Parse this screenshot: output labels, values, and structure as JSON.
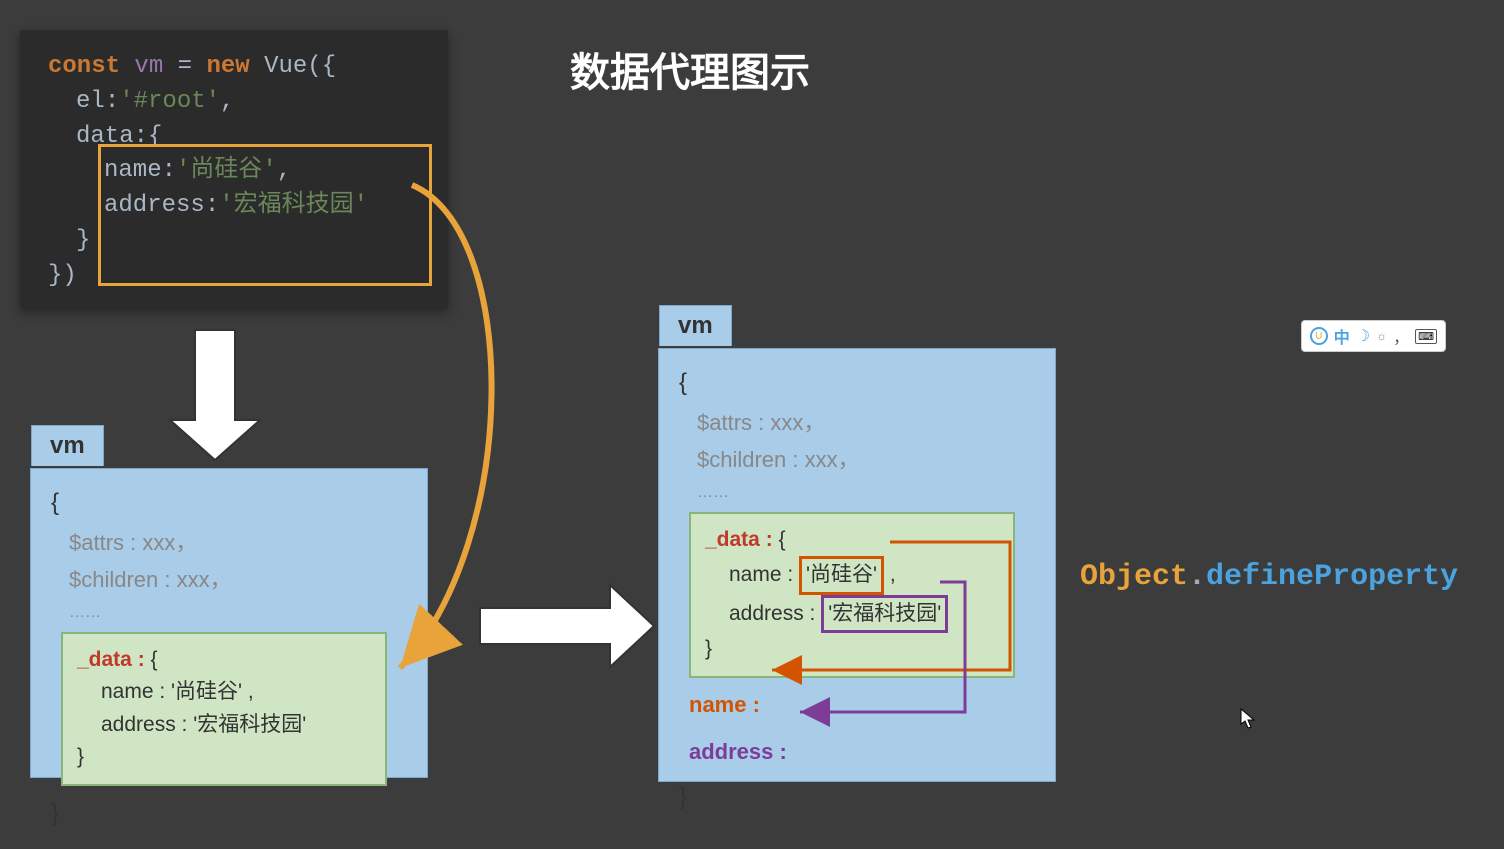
{
  "title": "数据代理图示",
  "code": {
    "const_kw": "const",
    "varname": "vm",
    "eq": "=",
    "new_kw": "new",
    "class_name": "Vue",
    "el_prop": "el",
    "el_val": "'#root'",
    "data_prop": "data",
    "name_prop": "name",
    "name_val": "'尚硅谷'",
    "address_prop": "address",
    "address_val": "'宏福科技园'"
  },
  "vm_left": {
    "label": "vm",
    "attrs": "$attrs : xxx，",
    "children": "$children : xxx，",
    "ellipsis": "……",
    "data_label": "_data :",
    "name_line": "name : '尚硅谷' ,",
    "address_line": "address : '宏福科技园'"
  },
  "vm_right": {
    "label": "vm",
    "attrs": "$attrs : xxx，",
    "children": "$children : xxx，",
    "ellipsis": "……",
    "data_label": "_data :",
    "name_key": "name :",
    "name_val": "'尚硅谷'",
    "name_comma": " ,",
    "address_key": "address :",
    "address_val": "'宏福科技园'",
    "proxy_name": "name :",
    "proxy_address": "address :"
  },
  "odp": {
    "obj": "Object",
    "dot": ".",
    "method": "defineProperty"
  },
  "ime": {
    "lang": "中",
    "comma": "，",
    "sun": "☼"
  }
}
